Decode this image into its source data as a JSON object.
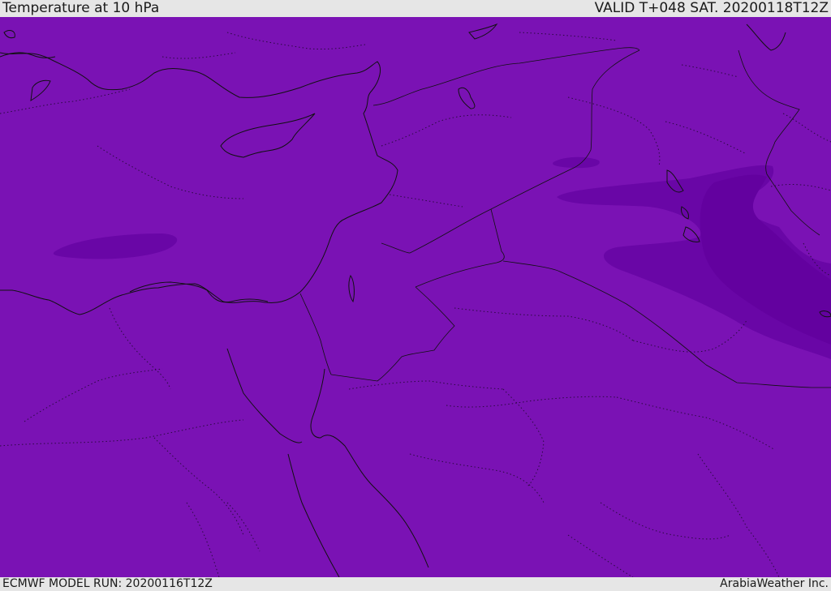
{
  "header": {
    "title": "Temperature at 10 hPa",
    "valid_time": "VALID T+048 SAT. 20200118T12Z"
  },
  "footer": {
    "model_run": "ECMWF MODEL RUN: 20200116T12Z",
    "credit": "ArabiaWeather Inc."
  },
  "colors": {
    "field_base": "#7a12b4",
    "field_cold": "#6906a6",
    "field_colder": "#63019f",
    "coastline": "#111111",
    "border_dotted": "#2a0a40"
  }
}
